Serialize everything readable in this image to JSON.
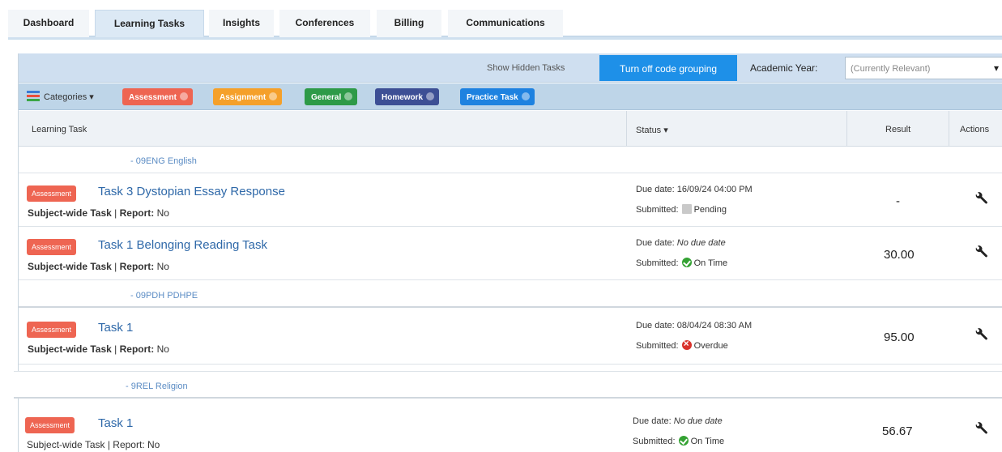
{
  "tabs": [
    {
      "label": "Dashboard",
      "active": false
    },
    {
      "label": "Learning Tasks",
      "active": true
    },
    {
      "label": "Insights",
      "active": false
    },
    {
      "label": "Conferences",
      "active": false
    },
    {
      "label": "Billing",
      "active": false
    },
    {
      "label": "Communications",
      "active": false
    }
  ],
  "toolbar": {
    "show_hidden": "Show Hidden Tasks",
    "grouping_button": "Turn off code grouping",
    "year_label": "Academic Year:",
    "year_value": "(Currently Relevant)"
  },
  "categories": {
    "label": "Categories ▾",
    "chips": [
      {
        "label": "Assessment",
        "color": "#ee6552"
      },
      {
        "label": "Assignment",
        "color": "#f5a02a"
      },
      {
        "label": "General",
        "color": "#2e9a48"
      },
      {
        "label": "Homework",
        "color": "#3d4f95"
      },
      {
        "label": "Practice Task",
        "color": "#1e82e0"
      }
    ]
  },
  "table": {
    "headers": {
      "task": "Learning Task",
      "status": "Status ▾",
      "result": "Result",
      "actions": "Actions"
    }
  },
  "groups": [
    {
      "label": "- 09ENG English"
    },
    {
      "label": "- 09PDH PDHPE"
    },
    {
      "label": "- 9REL Religion"
    }
  ],
  "tasks": [
    {
      "badge": "Assessment",
      "title": "Task 3 Dystopian Essay Response",
      "meta_a": "Subject-wide Task",
      "meta_sep": " | ",
      "meta_b": "Report:",
      "meta_c": " No",
      "due_label": "Due date: ",
      "due_value": "16/09/24 04:00 PM",
      "sub_label": "Submitted:",
      "sub_status": "Pending",
      "sub_icon": "pending-icon",
      "result": "-"
    },
    {
      "badge": "Assessment",
      "title": "Task 1 Belonging Reading Task",
      "meta_a": "Subject-wide Task",
      "meta_sep": " | ",
      "meta_b": "Report:",
      "meta_c": " No",
      "due_label": "Due date: ",
      "due_value": "No due date",
      "sub_label": "Submitted:",
      "sub_status": "On Time",
      "sub_icon": "on-time-icon",
      "result": "30.00"
    },
    {
      "badge": "Assessment",
      "title": "Task 1",
      "meta_a": "Subject-wide Task",
      "meta_sep": " | ",
      "meta_b": "Report:",
      "meta_c": " No",
      "due_label": "Due date: ",
      "due_value": "08/04/24 08:30 AM",
      "sub_label": "Submitted:",
      "sub_status": "Overdue",
      "sub_icon": "overdue-icon",
      "result": "95.00"
    },
    {
      "badge": "Assessment",
      "title": "Task 1",
      "meta_a": "Subject-wide Task",
      "meta_sep": " | ",
      "meta_b": "Report:",
      "meta_c": " No",
      "due_label": "Due date: ",
      "due_value": "No due date",
      "sub_label": "Submitted:",
      "sub_status": "On Time",
      "sub_icon": "on-time-icon",
      "result": "56.67"
    }
  ]
}
